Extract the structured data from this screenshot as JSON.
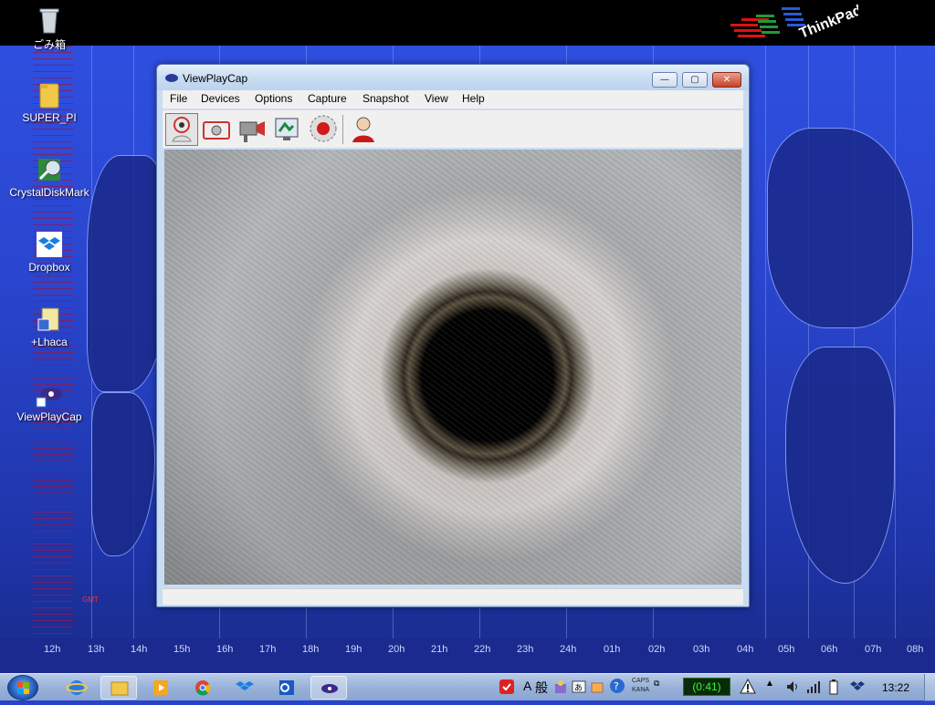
{
  "desktop": {
    "icons": [
      {
        "label": "ごみ箱",
        "icon": "recycle-bin-icon"
      },
      {
        "label": "SUPER_PI",
        "icon": "folder-icon"
      },
      {
        "label": "CrystalDiskMark",
        "icon": "crystaldiskmark-icon"
      },
      {
        "label": "Dropbox",
        "icon": "dropbox-icon"
      },
      {
        "label": "+Lhaca",
        "icon": "lhaca-icon"
      },
      {
        "label": "ViewPlayCap",
        "icon": "viewplaycap-icon"
      }
    ],
    "gmt_label": "GMT",
    "time_labels": [
      "12h",
      "13h",
      "14h",
      "15h",
      "16h",
      "17h",
      "18h",
      "19h",
      "20h",
      "21h",
      "22h",
      "23h",
      "24h",
      "01h",
      "02h",
      "03h",
      "04h",
      "05h",
      "06h",
      "07h",
      "08h"
    ],
    "logo_text": "ThinkPad"
  },
  "window": {
    "title": "ViewPlayCap",
    "controls": {
      "minimize": "—",
      "maximize": "▢",
      "close": "✕"
    },
    "menu": [
      "File",
      "Devices",
      "Options",
      "Capture",
      "Snapshot",
      "View",
      "Help"
    ],
    "toolbar": [
      {
        "icon": "webcam-icon",
        "active": true
      },
      {
        "icon": "camera-icon",
        "active": false
      },
      {
        "icon": "video-camera-icon",
        "active": false
      },
      {
        "icon": "display-settings-icon",
        "active": false
      },
      {
        "icon": "record-icon",
        "active": false
      },
      {
        "icon": "user-icon",
        "active": false
      }
    ]
  },
  "taskbar": {
    "apps": [
      "ie-icon",
      "explorer-icon",
      "media-player-icon",
      "chrome-icon",
      "dropbox-icon",
      "outlook-icon",
      "viewplaycap-icon"
    ],
    "ime_a": "A",
    "ime_mode": "般",
    "caps": "CAPS",
    "kana": "KANA",
    "battery": "(0:41)",
    "clock": "13:22"
  }
}
